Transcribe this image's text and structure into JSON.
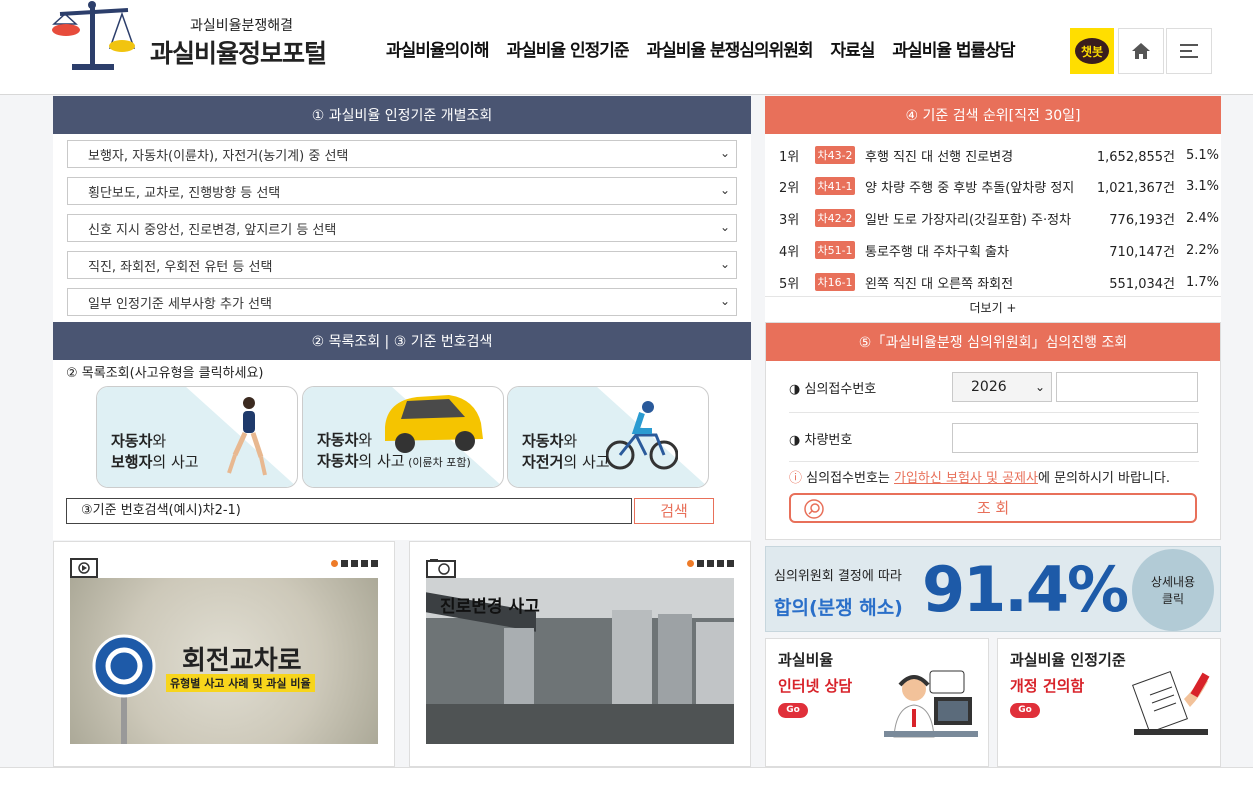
{
  "header": {
    "logo_sub": "과실비율분쟁해결",
    "logo_title": "과실비율정보포털",
    "nav": [
      "과실비율의이해",
      "과실비율 인정기준",
      "과실비율 분쟁심의위원회",
      "자료실",
      "과실비율 법률상담"
    ],
    "chatbot": "챗봇",
    "home_icon": "home-icon",
    "menu_icon": "hamburger-icon"
  },
  "lookup": {
    "title": "① 과실비율 인정기준 개별조회",
    "selects": [
      "보행자, 자동차(이륜차), 자전거(농기계) 중 선택",
      "횡단보도, 교차로, 진행방향 등 선택",
      "신호 지시 중앙선, 진로변경, 앞지르기 등 선택",
      "직진, 좌회전, 우회전 유턴 등 선택",
      "일부 인정기준 세부사항 추가 선택"
    ]
  },
  "list": {
    "title": "② 목록조회 | ③ 기준 번호검색",
    "subtitle": "② 목록조회(사고유형을 클릭하세요)",
    "cards": [
      {
        "l1a": "자동차",
        "l1b": "와",
        "l2a": "보행자",
        "l2b": "의 사고",
        "l2c": ""
      },
      {
        "l1a": "자동차",
        "l1b": "와",
        "l2a": "자동차",
        "l2b": "의 사고",
        "l2c": " (이륜차 포함)"
      },
      {
        "l1a": "자동차",
        "l1b": "와",
        "l2a": "자전거",
        "l2b": "의 사고",
        "l2c": ""
      }
    ],
    "search_placeholder": "③기준 번호검색(예시)차2-1)",
    "search_button": "검색"
  },
  "ranking": {
    "title": "④ 기준 검색 순위[직전 30일]",
    "rows": [
      {
        "rank": "1위",
        "code": "차43-2",
        "title": "후행 직진 대 선행 진로변경",
        "count": "1,652,855건",
        "pct": "5.1%"
      },
      {
        "rank": "2위",
        "code": "차41-1",
        "title": "양 차량 주행 중 후방 추돌(앞차량 정지",
        "count": "1,021,367건",
        "pct": "3.1%"
      },
      {
        "rank": "3위",
        "code": "차42-2",
        "title": "일반 도로 가장자리(갓길포함) 주·정차",
        "count": "776,193건",
        "pct": "2.4%"
      },
      {
        "rank": "4위",
        "code": "차51-1",
        "title": "통로주행 대 주차구획 출차",
        "count": "710,147건",
        "pct": "2.2%"
      },
      {
        "rank": "5위",
        "code": "차16-1",
        "title": "왼쪽 직진 대 오른쪽 좌회전",
        "count": "551,034건",
        "pct": "1.7%"
      }
    ],
    "more": "더보기 +"
  },
  "committee": {
    "title": "⑤「과실비율분쟁 심의위원회」심의진행 조회",
    "receipt_label": "심의접수번호",
    "year": "2026",
    "vehicle_label": "차량번호",
    "notice_prefix": "심의접수번호는 ",
    "notice_link": "가입하신 보험사 및 공제사",
    "notice_suffix": "에 문의하시기 바랍니다.",
    "search_button": "조 회"
  },
  "stats": {
    "line1": "심의위원회 결정에 따라",
    "line2": "합의(분쟁 해소)",
    "value": "91.4%",
    "detail_l1": "상세내용",
    "detail_l2": "클릭"
  },
  "video1": {
    "title_main": "회전교차로",
    "title_sub": "유형별 사고 사례 및 과실 비율"
  },
  "video2": {
    "title": "진로변경 사고"
  },
  "consult": {
    "l1": "과실비율",
    "l2": "인터넷 상담",
    "go": "Go"
  },
  "revision": {
    "l1": "과실비율 인정기준",
    "l2": "개정 건의함",
    "go": "Go"
  }
}
